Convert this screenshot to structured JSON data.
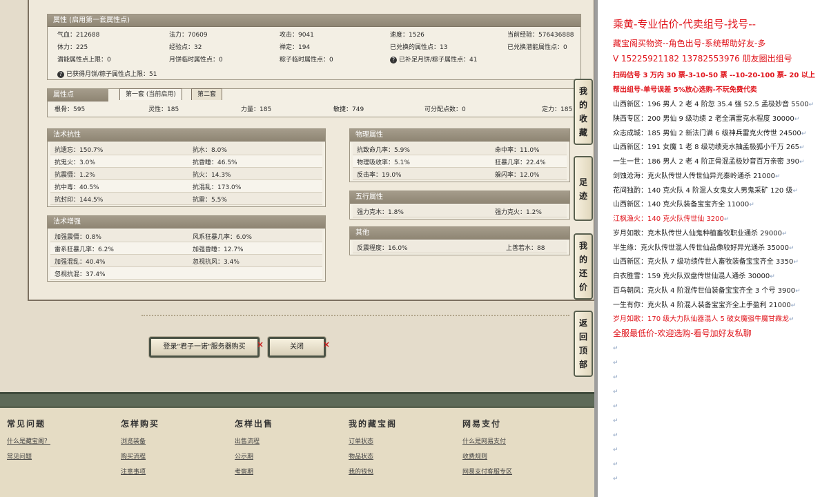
{
  "attributes": {
    "title": "属性 (启用第一套属性点)",
    "rows": [
      [
        [
          "气血：212688"
        ],
        [
          "法力：70609"
        ],
        [
          "攻击：9041"
        ],
        [
          "速度：1526"
        ],
        [
          "当前经验：576436888"
        ]
      ],
      [
        [
          "体力：225"
        ],
        [
          "经验点：32"
        ],
        [
          "禅定：194"
        ],
        [
          "已兑换的属性点：13"
        ],
        [
          "已兑换潜能属性点：0"
        ]
      ],
      [
        [
          "潜能属性点上限：0"
        ],
        [
          "月饼临时属性点：0"
        ],
        [
          "粽子临时属性点：0"
        ],
        [
          "已补足月饼/粽子属性点：41"
        ]
      ]
    ],
    "note": "已获得月饼/粽子属性点上限：51"
  },
  "points": {
    "title": "属性点",
    "tabs": [
      "第一套 (当前启用)",
      "第二套"
    ],
    "values": [
      "根骨：595",
      "灵性：185",
      "力量：185",
      "敏捷：749",
      "可分配点数：0",
      "定力：185"
    ]
  },
  "magic_resist": {
    "title": "法术抗性",
    "rows": [
      [
        "抗遗忘：150.7%",
        "抗水：8.0%"
      ],
      [
        "抗鬼火：3.0%",
        "抗昏睡：46.5%"
      ],
      [
        "抗震慑：1.2%",
        "抗火：14.3%"
      ],
      [
        "抗中毒：40.5%",
        "抗混乱：173.0%"
      ],
      [
        "抗封印：144.5%",
        "抗雷：5.5%"
      ]
    ]
  },
  "magic_boost": {
    "title": "法术增强",
    "rows": [
      [
        "加强震慑：0.8%",
        "风系狂暴几率：6.0%"
      ],
      [
        "雷系狂暴几率：6.2%",
        "加强昏睡：12.7%"
      ],
      [
        "加强混乱：40.4%",
        "忽视抗风：3.4%"
      ],
      [
        "忽视抗混：37.4%",
        ""
      ]
    ]
  },
  "physical": {
    "title": "物理属性",
    "rows": [
      [
        "抗致命几率：5.9%",
        "命中率：11.0%"
      ],
      [
        "物理吸收率：5.1%",
        "狂暴几率：22.4%"
      ],
      [
        "反击率：19.0%",
        "躲闪率：12.0%"
      ]
    ]
  },
  "five_elements": {
    "title": "五行属性",
    "rows": [
      [
        "强力克木：1.8%",
        "强力克火：1.2%"
      ]
    ]
  },
  "other": {
    "title": "其他",
    "rows": [
      [
        "反震程度：16.0%",
        "上善若水：88"
      ]
    ]
  },
  "buttons": {
    "buy": "登录\"君子一诺\"服务器购买",
    "close": "关闭"
  },
  "side_buttons": [
    "我的收藏",
    "足迹",
    "我的还价",
    "返回顶部"
  ],
  "footer": [
    {
      "title": "常见问题",
      "links": [
        "什么是藏宝阁？",
        "常见问题"
      ]
    },
    {
      "title": "怎样购买",
      "links": [
        "浏览装备",
        "购买流程",
        "注意事项"
      ]
    },
    {
      "title": "怎样出售",
      "links": [
        "出售流程",
        "公示期",
        "考察期"
      ]
    },
    {
      "title": "我的藏宝阁",
      "links": [
        "订单状态",
        "物品状态",
        "我的钱包"
      ]
    },
    {
      "title": "网易支付",
      "links": [
        "什么是网易支付",
        "收费规则",
        "网易支付客服专区"
      ]
    }
  ],
  "right": {
    "title": "乘黄-专业估价-代卖组号-找号--",
    "line1": "藏宝阁买物资--角色出号-系统帮助好友-多",
    "line2": "V 15225921182   13782553976  朋友圈出组号",
    "line3": "扫码估号 3 万内 30 票-3-10-50 票 --10-20-100 票- 20 以上",
    "line4": "帮出组号-单号误差 5%放心选购-不玩免费代卖",
    "listings": [
      {
        "text": "山西新区：196 男人 2 老 4 阶忽 35.4 强 52.5 孟极妙音 5500",
        "red": false
      },
      {
        "text": "陕西专区：200 男仙 9 级功绩 2 老全满雷克水程度 30000",
        "red": false
      },
      {
        "text": "众志成城：185 男仙 2 新法门满 6 级神兵雷克火传世 24500",
        "red": false
      },
      {
        "text": "山西新区：191 女魔 1 老 8 级功绩克水抽孟极狐小千万 265",
        "red": false
      },
      {
        "text": "一生一世：186 男人 2 老 4 阶正骨混孟极妙音百万亲密 390",
        "red": false
      },
      {
        "text": "剑蚀沧海：克火队传世人传世仙异光秦岭通杀 21000",
        "red": false
      },
      {
        "text": "花间独酌：140 克火队 4 阶混人女鬼女人男鬼采矿 120 级",
        "red": false
      },
      {
        "text": "山西新区：140 克火队装备宝宝齐全 11000",
        "red": false
      },
      {
        "text": "江枫渔火：140 克火队传世仙 3200",
        "red": true
      },
      {
        "text": "岁月如歌：克木队传世人仙鬼种植畜牧职业通杀 29000",
        "red": false
      },
      {
        "text": "半生缘：克火队传世混人传世仙品像较好异光通杀 35000",
        "red": false
      },
      {
        "text": "山西新区：克火队 7 级功绩传世人畜牧装备宝宝齐全 3350",
        "red": false
      },
      {
        "text": "白衣胜雪：159 克火队双盘传世仙混人通杀 30000",
        "red": false
      },
      {
        "text": "百鸟朝凤：克火队 4 阶混传世仙装备宝宝齐全 3 个号 3900",
        "red": false
      },
      {
        "text": "一生有你：克火队 4 阶混人装备宝宝齐全上手盈利 21000",
        "red": false
      },
      {
        "text": "岁月如歌：170 级大力队仙器混人 5 破女魔强牛魔甘霖龙",
        "red": true
      }
    ],
    "closing": "全服最低价-欢迎选购-看号加好友私聊"
  }
}
